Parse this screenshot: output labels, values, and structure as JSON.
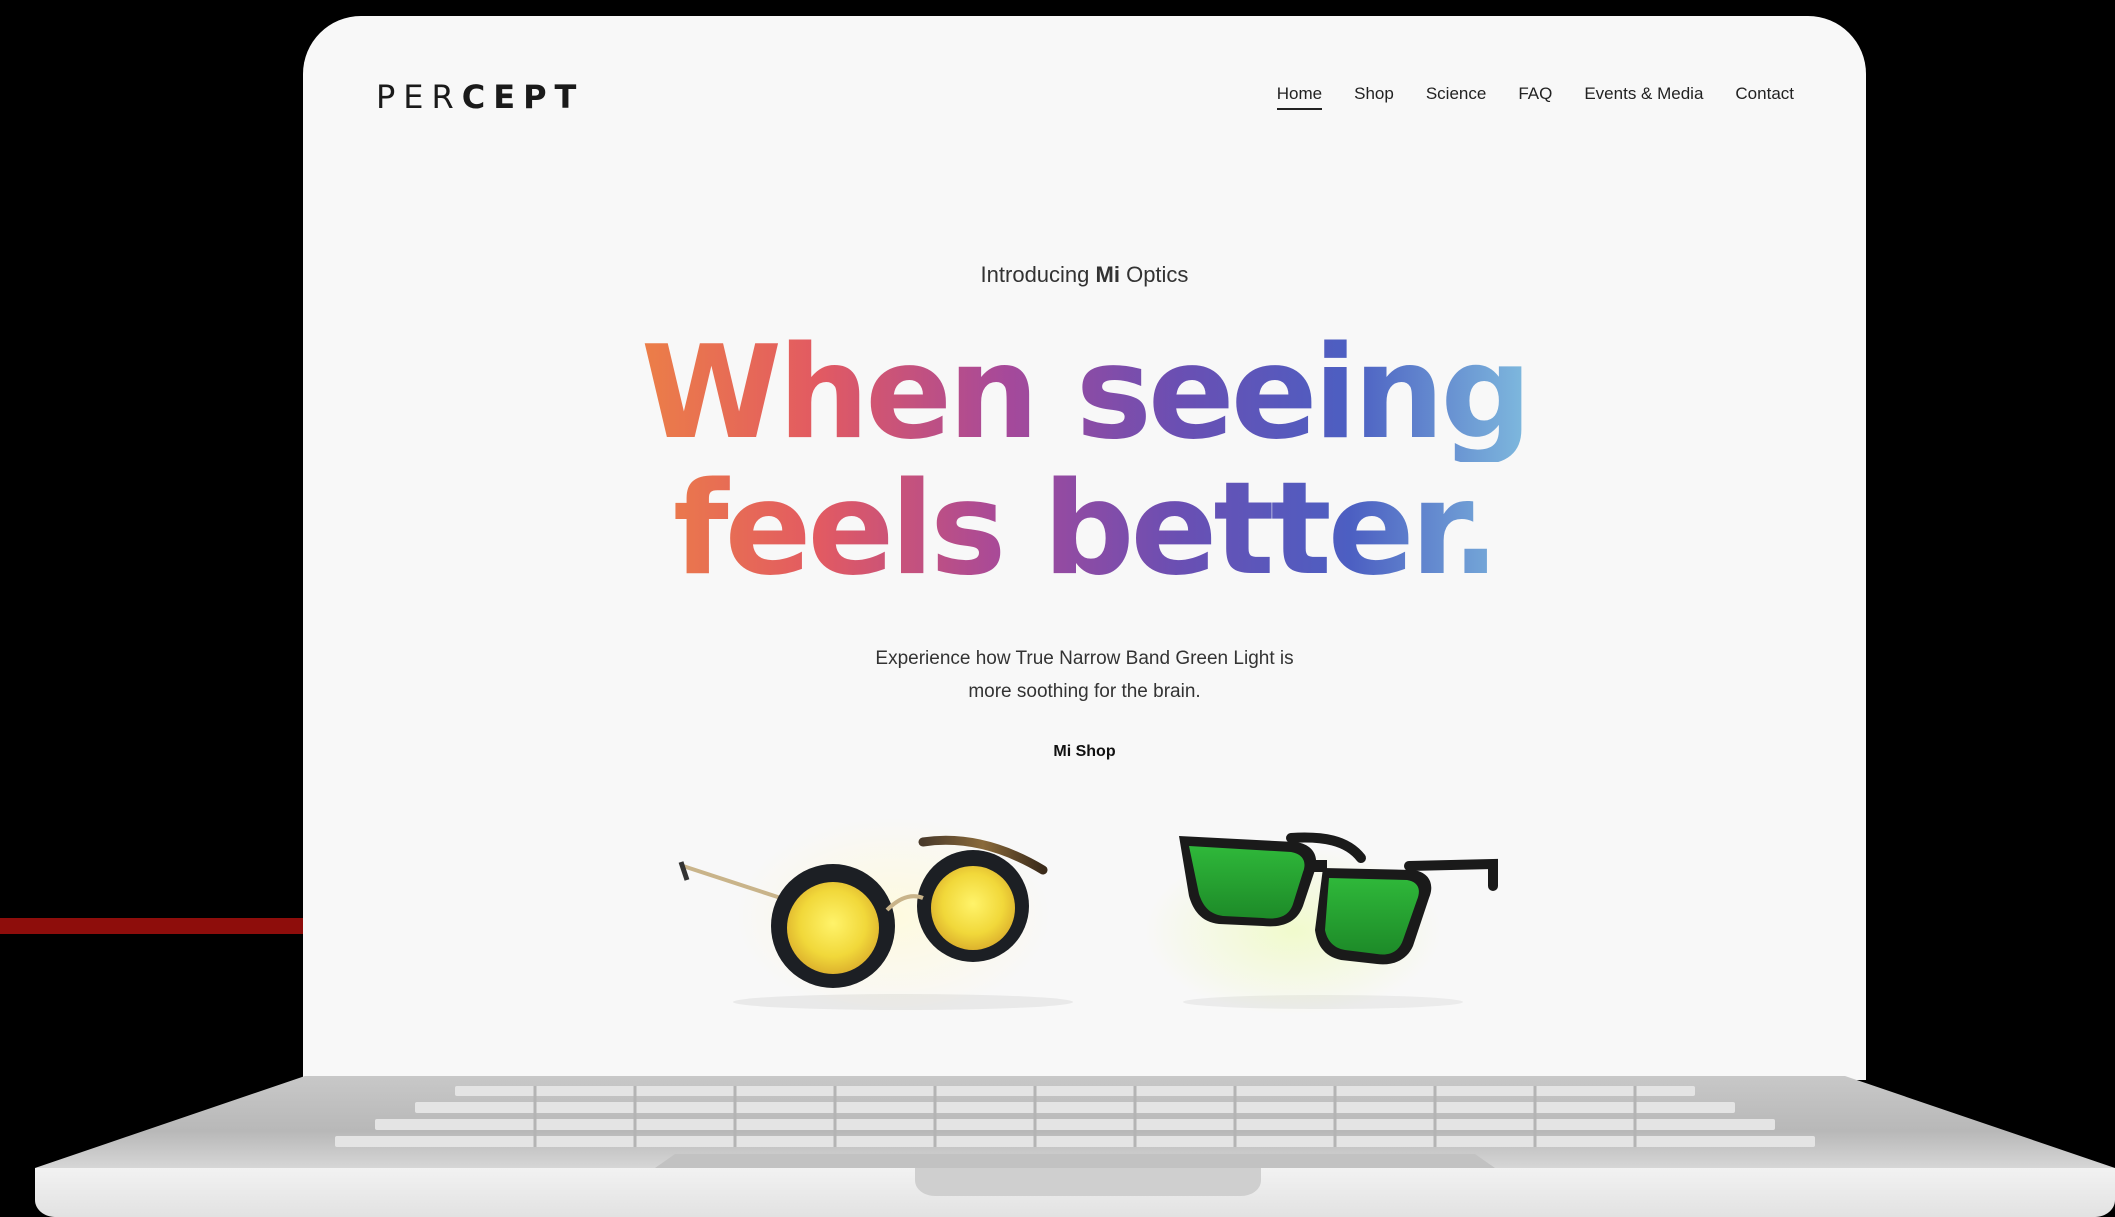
{
  "site": {
    "logo_light": "PER",
    "logo_bold": "CEPT"
  },
  "nav": {
    "items": [
      {
        "label": "Home",
        "active": true
      },
      {
        "label": "Shop"
      },
      {
        "label": "Science"
      },
      {
        "label": "FAQ"
      },
      {
        "label": "Events & Media"
      },
      {
        "label": "Contact"
      }
    ]
  },
  "hero": {
    "intro_prefix": "Introducing ",
    "intro_strong": "Mi",
    "intro_suffix": " Optics",
    "headline_line1": "When seeing",
    "headline_line2": "feels better.",
    "subtitle_line1": "Experience how True Narrow Band Green Light is",
    "subtitle_line2": "more soothing for the brain.",
    "cta": "Mi Shop"
  },
  "products": [
    {
      "icon": "round-yellow-lens-glasses-icon"
    },
    {
      "icon": "green-lens-sunglasses-icon"
    }
  ],
  "colors": {
    "page_background": "#000000",
    "screen_background": "#f8f8f8",
    "accent_red_line": "#8e0d0b",
    "gradient": [
      "#f6c23e",
      "#ef8a3f",
      "#e25a62",
      "#a6499a",
      "#6a4fb3",
      "#4c5fc2",
      "#7db7dd",
      "#5fbf8a",
      "#4db84f"
    ]
  }
}
